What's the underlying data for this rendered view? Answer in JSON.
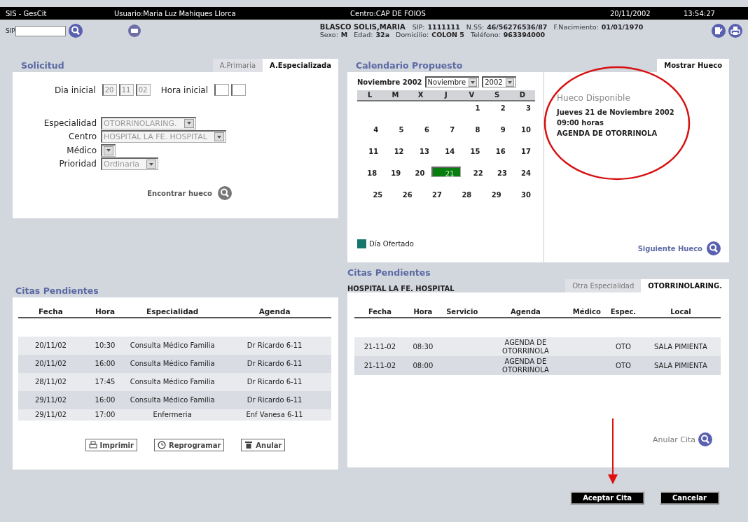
{
  "top_bar": {
    "app": "SIS - GesCit",
    "user": "Usuario:Maria Luz Mahiques Llorca",
    "center": "Centro:CAP DE FOIOS",
    "date": "20/11/2002",
    "time": "13:54:27"
  },
  "patient_bar": {
    "sip_label": "SIP",
    "name": "BLASCO SOLIS,MARIA",
    "line1": [
      {
        "label": "SIP:",
        "value": "1111111"
      },
      {
        "label": "N.SS:",
        "value": "46/56276536/87"
      },
      {
        "label": "F.Nacimiento:",
        "value": "01/01/1970"
      }
    ],
    "line2": [
      {
        "label": "Sexo:",
        "value": "M"
      },
      {
        "label": "Edad:",
        "value": "32a"
      },
      {
        "label": "Domicilio:",
        "value": "COLON 5"
      },
      {
        "label": "Teléfono:",
        "value": "963394000"
      }
    ]
  },
  "solicitud": {
    "title": "Solicitud",
    "tabs": [
      {
        "label": "A.Primaria",
        "selected": false
      },
      {
        "label": "A.Especializada",
        "selected": true
      }
    ],
    "dia_inicial": {
      "label": "Dia inicial",
      "values": [
        "20",
        "11",
        "02"
      ]
    },
    "hora_inicial": {
      "label": "Hora inicial"
    },
    "selects": [
      {
        "label": "Especialidad",
        "value": "OTORRINOLARING."
      },
      {
        "label": "Centro",
        "value": "HOSPITAL LA FE. HOSPITAL"
      },
      {
        "label": "Médico"
      },
      {
        "label": "Prioridad",
        "value": "Ordinaria"
      }
    ],
    "find_button": "Encontrar hueco"
  },
  "calendario": {
    "title": "Calendario Propuesto",
    "tab": "Mostrar Hueco",
    "month_label": "Noviembre 2002",
    "month_select": "Noviembre",
    "year_select": "2002",
    "weekdays": [
      "L",
      "M",
      "X",
      "J",
      "V",
      "S",
      "D"
    ],
    "weeks": [
      [
        {
          "day": "1",
          "selected": false
        },
        {
          "day": "2",
          "selected": false
        },
        {
          "day": "3",
          "selected": false
        }
      ],
      [
        {
          "day": "4",
          "selected": false
        },
        {
          "day": "5",
          "selected": false
        },
        {
          "day": "6",
          "selected": false
        },
        {
          "day": "7",
          "selected": false
        },
        {
          "day": "8",
          "selected": false
        },
        {
          "day": "9",
          "selected": false
        },
        {
          "day": "10",
          "selected": false
        }
      ],
      [
        {
          "day": "11",
          "selected": false
        },
        {
          "day": "12",
          "selected": false
        },
        {
          "day": "13",
          "selected": false
        },
        {
          "day": "14",
          "selected": false
        },
        {
          "day": "15",
          "selected": false
        },
        {
          "day": "16",
          "selected": false
        },
        {
          "day": "17",
          "selected": false
        }
      ],
      [
        {
          "day": "18",
          "selected": false
        },
        {
          "day": "19",
          "selected": false
        },
        {
          "day": "20",
          "selected": false
        },
        {
          "day": "21",
          "selected": true
        },
        {
          "day": "22",
          "selected": false
        },
        {
          "day": "23",
          "selected": false
        },
        {
          "day": "24",
          "selected": false
        }
      ],
      [
        {
          "day": "25",
          "selected": false
        },
        {
          "day": "26",
          "selected": false
        },
        {
          "day": "27",
          "selected": false
        },
        {
          "day": "28",
          "selected": false
        },
        {
          "day": "29",
          "selected": false
        },
        {
          "day": "30",
          "selected": false
        }
      ]
    ],
    "legend": {
      "label": "Día Ofertado",
      "color": "#17776b"
    },
    "hueco": {
      "title": "Hueco Disponible",
      "lines": [
        "Jueves 21 de Noviembre 2002",
        "09:00 horas",
        "AGENDA DE OTORRINOLA"
      ]
    },
    "next_button": "Siguiente Hueco"
  },
  "citas_left": {
    "title": "Citas Pendientes",
    "columns": [
      "Fecha",
      "Hora",
      "Especialidad",
      "Agenda"
    ],
    "rows": [
      {
        "fecha": "20/11/02",
        "hora": "10:30",
        "especialidad": "Consulta Médico Familia",
        "agenda": "Dr Ricardo 6-11"
      },
      {
        "fecha": "20/11/02",
        "hora": "16:00",
        "especialidad": "Consulta Médico Familia",
        "agenda": "Dr Ricardo 6-11"
      },
      {
        "fecha": "28/11/02",
        "hora": "17:45",
        "especialidad": "Consulta Médico Familia",
        "agenda": "Dr Ricardo 6-11"
      },
      {
        "fecha": "29/11/02",
        "hora": "16:00",
        "especialidad": "Consulta Médico Familia",
        "agenda": "Dr Ricardo 6-11"
      },
      {
        "fecha": "29/11/02",
        "hora": "17:00",
        "especialidad": "Enfermeria",
        "agenda": "Enf Vanesa 6-11"
      }
    ],
    "buttons": [
      {
        "label": "Imprimir",
        "kind": "print"
      },
      {
        "label": "Reprogramar",
        "kind": "clock"
      },
      {
        "label": "Anular",
        "kind": "trash"
      }
    ]
  },
  "citas_right": {
    "title": "Citas Pendientes",
    "subtitle": "HOSPITAL LA FE. HOSPITAL",
    "tabs": [
      {
        "label": "Otra Especialidad",
        "selected": false
      },
      {
        "label": "OTORRINOLARING.",
        "selected": true
      }
    ],
    "columns": [
      "Fecha",
      "Hora",
      "Servicio",
      "Agenda",
      "Médico",
      "Espec.",
      "Local"
    ],
    "rows": [
      {
        "fecha": "21-11-02",
        "hora": "08:30",
        "agenda": "AGENDA DE OTORRINOLA",
        "espec": "OTO",
        "local": "SALA PIMIENTA"
      },
      {
        "fecha": "21-11-02",
        "hora": "08:00",
        "agenda": "AGENDA DE OTORRINOLA",
        "espec": "OTO",
        "local": "SALA PIMIENTA"
      }
    ],
    "cancel_link": "Anular Cita"
  },
  "footer_buttons": [
    {
      "label": "Aceptar Cita"
    },
    {
      "label": "Cancelar"
    }
  ]
}
